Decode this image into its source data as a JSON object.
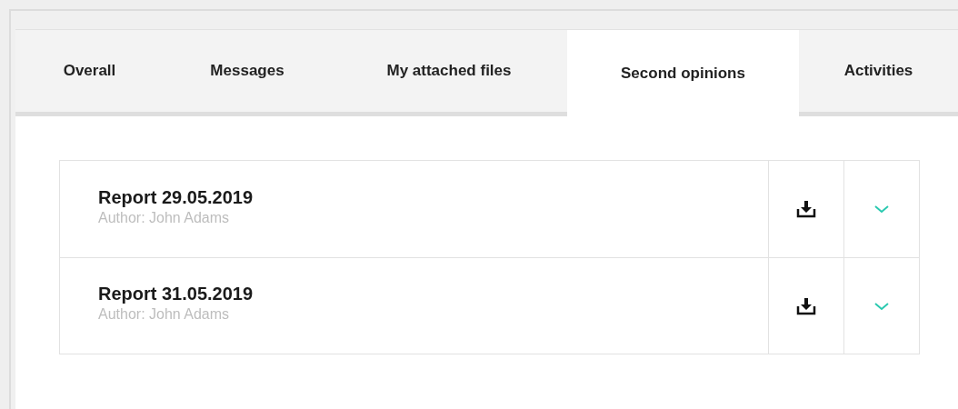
{
  "tabs": [
    {
      "label": "Overall",
      "selected": false
    },
    {
      "label": "Messages",
      "selected": false
    },
    {
      "label": "My attached files",
      "selected": false
    },
    {
      "label": "Second opinions",
      "selected": true
    },
    {
      "label": "Activities",
      "selected": false
    }
  ],
  "reports": [
    {
      "title": "Report 29.05.2019",
      "author": "Author: John Adams"
    },
    {
      "title": "Report 31.05.2019",
      "author": "Author: John Adams"
    }
  ]
}
